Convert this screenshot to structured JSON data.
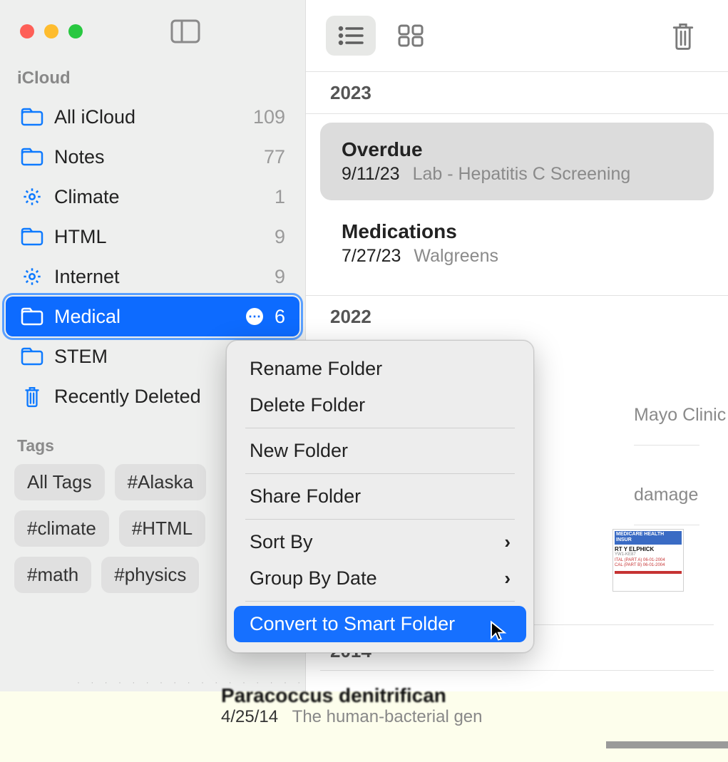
{
  "sidebar": {
    "section": "iCloud",
    "folders": [
      {
        "name": "All iCloud",
        "count": "109",
        "icon": "folder"
      },
      {
        "name": "Notes",
        "count": "77",
        "icon": "folder"
      },
      {
        "name": "Climate",
        "count": "1",
        "icon": "gear"
      },
      {
        "name": "HTML",
        "count": "9",
        "icon": "folder"
      },
      {
        "name": "Internet",
        "count": "9",
        "icon": "gear"
      },
      {
        "name": "Medical",
        "count": "6",
        "icon": "folder",
        "selected": true
      },
      {
        "name": "STEM",
        "count": "",
        "icon": "folder"
      },
      {
        "name": "Recently Deleted",
        "count": "",
        "icon": "trash"
      }
    ],
    "tags_label": "Tags",
    "tags": [
      "All Tags",
      "#Alaska",
      "#climate",
      "#HTML",
      "#math",
      "#physics"
    ]
  },
  "main": {
    "years": {
      "y0": "2023",
      "y1": "2022",
      "y2": "2014"
    },
    "notes_2023": [
      {
        "title": "Overdue",
        "date": "9/11/23",
        "preview": "Lab - Hepatitis C Screening",
        "selected": true
      },
      {
        "title": "Medications",
        "date": "7/27/23",
        "preview": "Walgreens"
      }
    ],
    "peek_text1": "Mayo Clinic",
    "peek_text2": "damage",
    "bottom": {
      "title": "Paracoccus denitrifican",
      "date": "4/25/14",
      "preview": "The human-bacterial gen"
    }
  },
  "context_menu": {
    "items": [
      {
        "label": "Rename Folder"
      },
      {
        "label": "Delete Folder"
      },
      {
        "sep": true
      },
      {
        "label": "New Folder"
      },
      {
        "sep": true
      },
      {
        "label": "Share Folder"
      },
      {
        "sep": true
      },
      {
        "label": "Sort By",
        "sub": true
      },
      {
        "label": "Group By Date",
        "sub": true
      },
      {
        "sep": true
      },
      {
        "label": "Convert to Smart Folder",
        "highlighted": true
      }
    ]
  },
  "thumb": {
    "header": "MEDICARE HEALTH INSUR",
    "name": "RT Y ELPHICK",
    "id": "YW1-KE87",
    "l1": "ITAL (PART A)  06-01-2004",
    "l2": "CAL (PART B)  06-01-2004"
  }
}
